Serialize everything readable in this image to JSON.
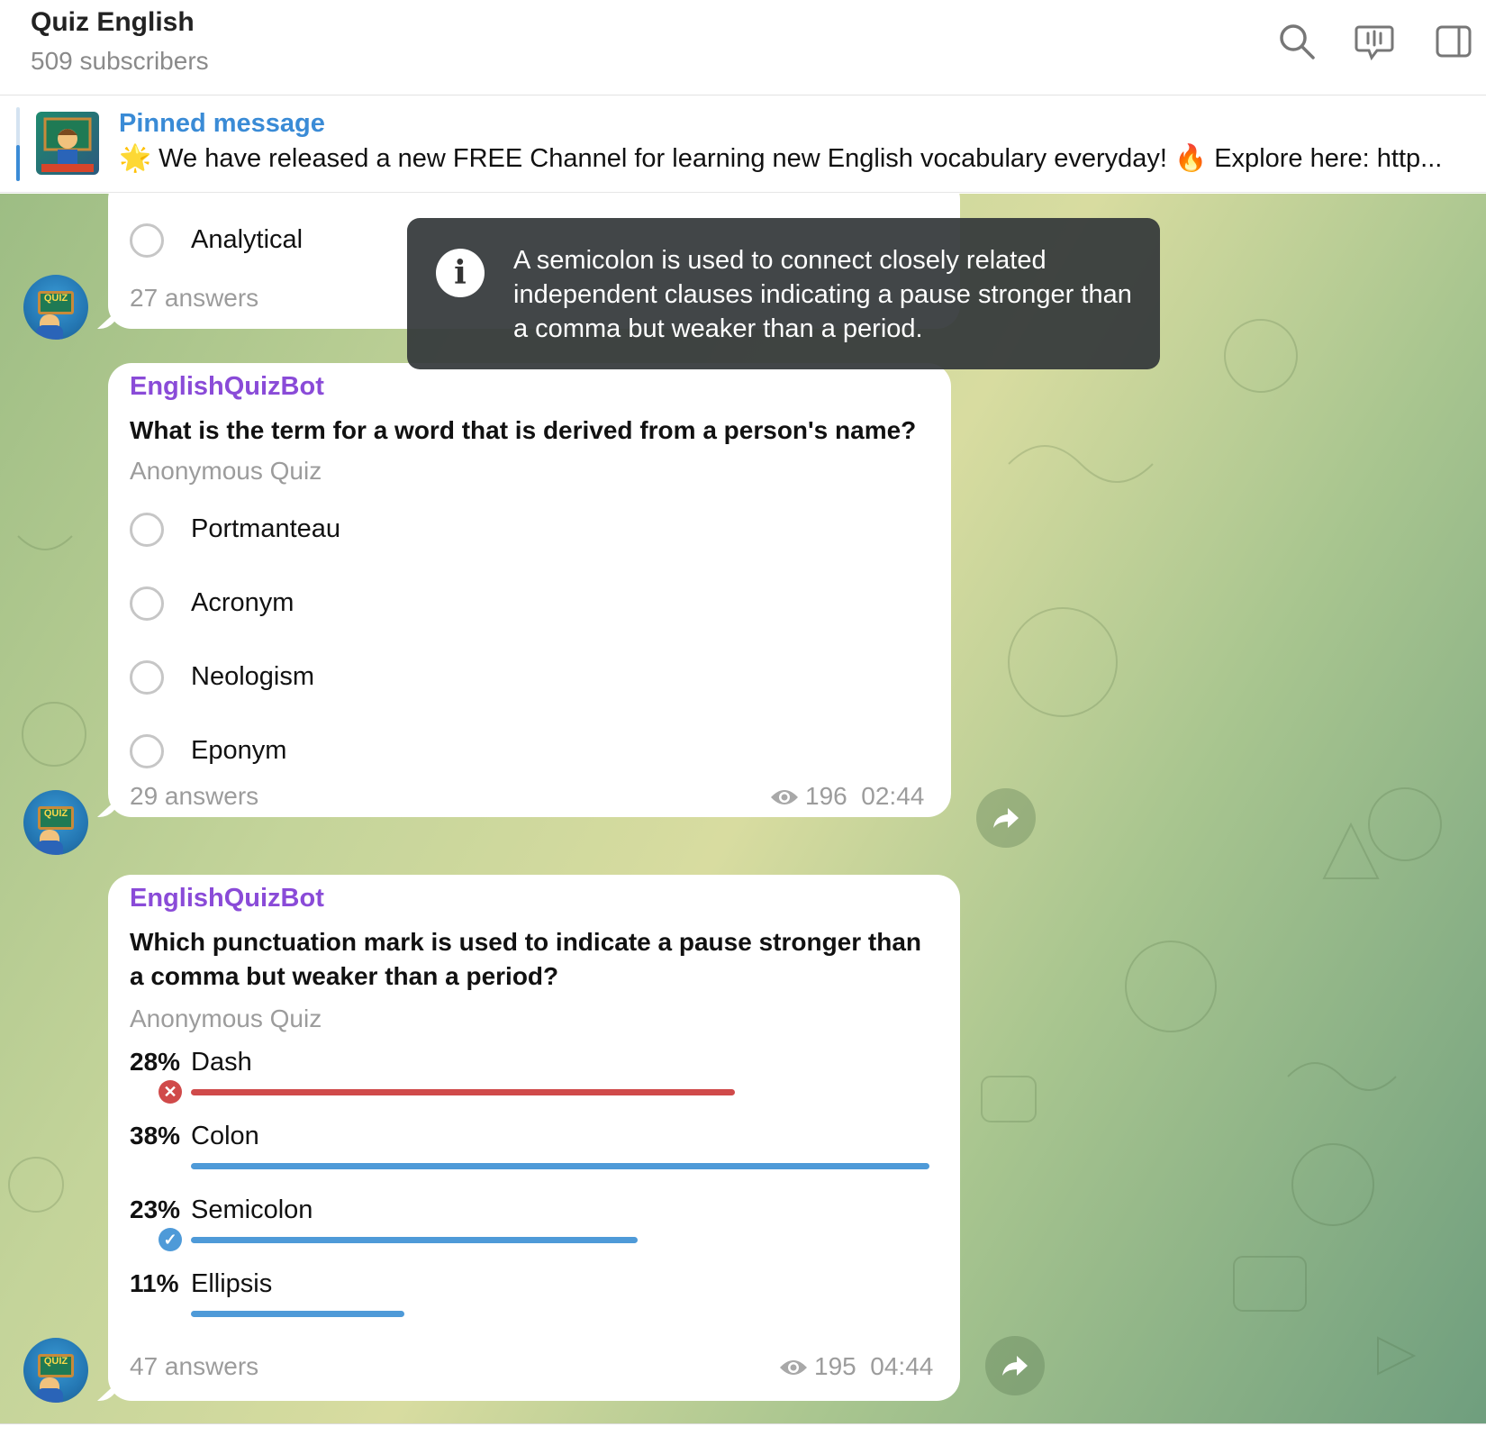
{
  "header": {
    "title": "Quiz English",
    "subtitle": "509 subscribers",
    "icons": [
      "search-icon",
      "live-stream-icon",
      "sidebar-toggle-icon"
    ]
  },
  "pinned": {
    "title": "Pinned message",
    "star_emoji": "🌟",
    "text": "We have released a new FREE Channel for learning new English vocabulary everyday!",
    "fire_emoji": "🔥",
    "text2": "Explore here: http..."
  },
  "toast": {
    "text": "A semicolon is used to connect closely related independent clauses indicating a pause stronger than a comma but weaker than a period."
  },
  "messages": [
    {
      "partial_option": "Analytical",
      "answers": "27 answers"
    },
    {
      "sender": "EnglishQuizBot",
      "question": "What is the term for a word that is derived from a person's name?",
      "quiz_type": "Anonymous Quiz",
      "options": [
        "Portmanteau",
        "Acronym",
        "Neologism",
        "Eponym"
      ],
      "answers": "29 answers",
      "views": "196",
      "time": "02:44"
    },
    {
      "sender": "EnglishQuizBot",
      "question": "Which punctuation mark is used to indicate a pause stronger than a comma but weaker than a period?",
      "quiz_type": "Anonymous Quiz",
      "results": [
        {
          "pct": "28%",
          "label": "Dash",
          "value": 28,
          "status": "wrong"
        },
        {
          "pct": "38%",
          "label": "Colon",
          "value": 38,
          "status": "none"
        },
        {
          "pct": "23%",
          "label": "Semicolon",
          "value": 23,
          "status": "correct"
        },
        {
          "pct": "11%",
          "label": "Ellipsis",
          "value": 11,
          "status": "none"
        }
      ],
      "answers": "47 answers",
      "views": "195",
      "time": "04:44"
    }
  ],
  "colors": {
    "accent": "#3a8bd6",
    "sender": "#8a4bd8",
    "wrong": "#d04a4a",
    "bar": "#4e9ad8",
    "correct": "#4e9ad8"
  }
}
